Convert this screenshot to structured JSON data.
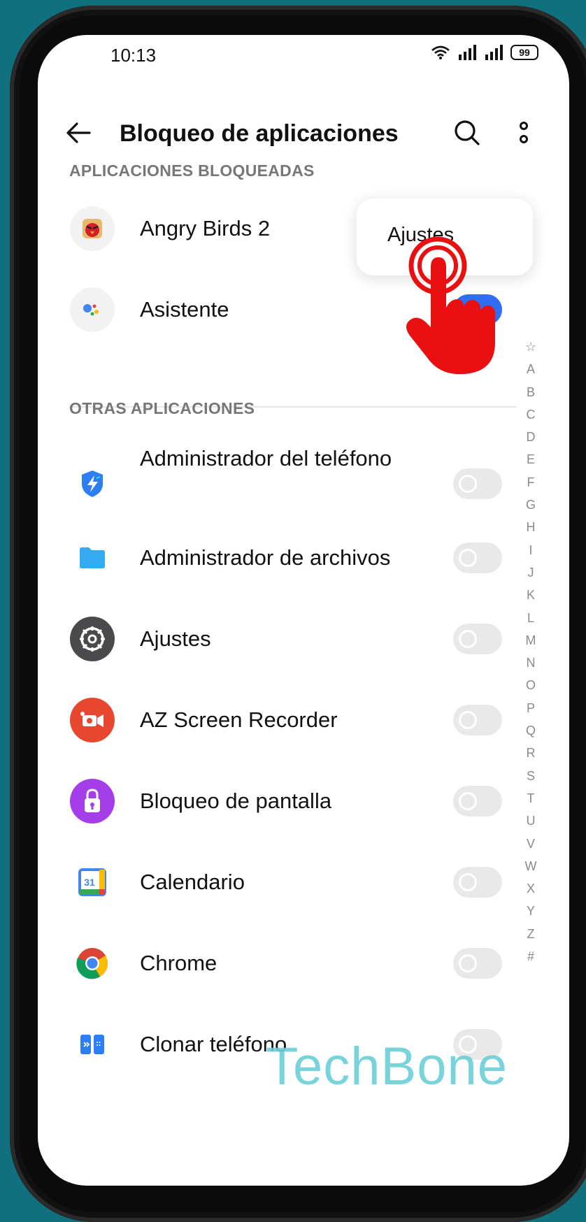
{
  "status_bar": {
    "time": "10:13",
    "battery": "99"
  },
  "toolbar": {
    "title": "Bloqueo de aplicaciones"
  },
  "sections": {
    "locked_header": "APLICACIONES BLOQUEADAS",
    "other_header": "OTRAS APLICACIONES"
  },
  "locked_apps": [
    {
      "label": "Angry Birds 2",
      "icon": "angry-birds-icon",
      "enabled": true
    },
    {
      "label": "Asistente",
      "icon": "assistant-icon",
      "enabled": true
    }
  ],
  "other_apps": [
    {
      "label": "Administrador del teléfono",
      "icon": "phone-manager-icon",
      "enabled": false
    },
    {
      "label": "Administrador de archivos",
      "icon": "folder-icon",
      "enabled": false
    },
    {
      "label": "Ajustes",
      "icon": "settings-gear-icon",
      "enabled": false
    },
    {
      "label": "AZ Screen Recorder",
      "icon": "screen-recorder-icon",
      "enabled": false
    },
    {
      "label": "Bloqueo de pantalla",
      "icon": "screen-lock-icon",
      "enabled": false
    },
    {
      "label": "Calendario",
      "icon": "calendar-icon",
      "enabled": false
    },
    {
      "label": "Chrome",
      "icon": "chrome-icon",
      "enabled": false
    },
    {
      "label": "Clonar teléfono",
      "icon": "clone-phone-icon",
      "enabled": false
    }
  ],
  "alpha_index": [
    "☆",
    "A",
    "B",
    "C",
    "D",
    "E",
    "F",
    "G",
    "H",
    "I",
    "J",
    "K",
    "L",
    "M",
    "N",
    "O",
    "P",
    "Q",
    "R",
    "S",
    "T",
    "U",
    "V",
    "W",
    "X",
    "Y",
    "Z",
    "#"
  ],
  "popup_menu": {
    "item": "Ajustes"
  },
  "watermark": "TechBone",
  "colors": {
    "background": "#11707e",
    "toggle_on": "#2f6df3",
    "toggle_off": "#e9e9e9",
    "hand": "#e81010",
    "watermark": "#6ad0d6"
  }
}
